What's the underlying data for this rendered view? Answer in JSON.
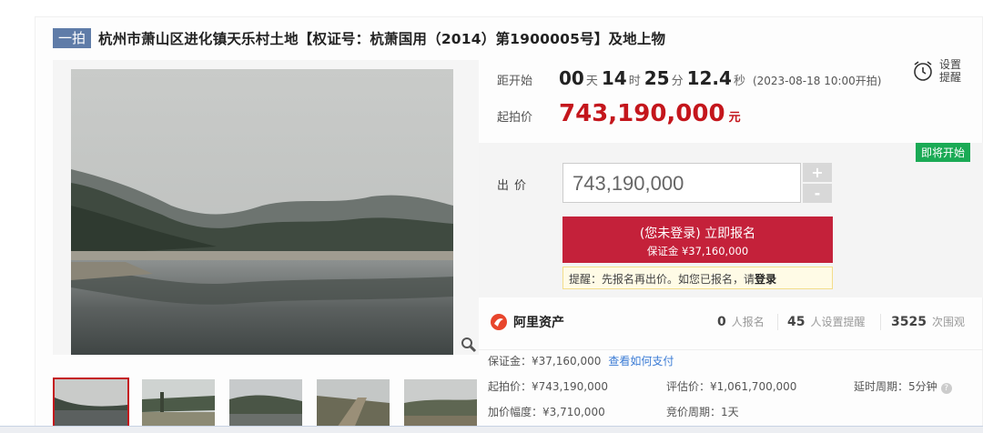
{
  "header": {
    "round_badge": "一拍",
    "title": "杭州市萧山区进化镇天乐村土地【权证号：杭萧国用（2014）第1900005号】及地上物"
  },
  "countdown": {
    "label": "距开始",
    "days": "00",
    "days_unit": "天",
    "hours": "14",
    "hours_unit": "时",
    "minutes": "25",
    "minutes_unit": "分",
    "seconds": "12.4",
    "seconds_unit": "秒",
    "note": "(2023-08-18 10:00开拍)"
  },
  "reminder": {
    "label": "设置提醒",
    "icon": "alarm-clock-icon"
  },
  "start_price": {
    "label": "起拍价",
    "value": "743,190,000",
    "unit": "元"
  },
  "status_tag": "即将开始",
  "bid": {
    "label": "出价",
    "value": "743,190,000",
    "plus": "+",
    "minus": "-"
  },
  "signup": {
    "main": "(您未登录) 立即报名",
    "deposit": "保证金 ¥37,160,000"
  },
  "tip": {
    "text": "提醒：先报名再出价。如您已报名，请",
    "login": "登录"
  },
  "platform": {
    "name": "阿里资产"
  },
  "stats": [
    {
      "num": "0",
      "label": "人报名"
    },
    {
      "num": "45",
      "label": "人设置提醒"
    },
    {
      "num": "3525",
      "label": "次围观"
    }
  ],
  "details": {
    "deposit": "保证金：¥37,160,000",
    "pay_link": "查看如何支付",
    "start_price": "起拍价：¥743,190,000",
    "appraisal": "评估价：¥1,061,700,000",
    "delay": "延时周期：5分钟",
    "increment": "加价幅度：¥3,710,000",
    "cycle": "竞价周期：1天"
  },
  "colors": {
    "accent": "#c4161c",
    "button": "#c4213a",
    "badge": "#5f7ca8",
    "tag": "#1aaa55",
    "link": "#3a7bd5"
  }
}
